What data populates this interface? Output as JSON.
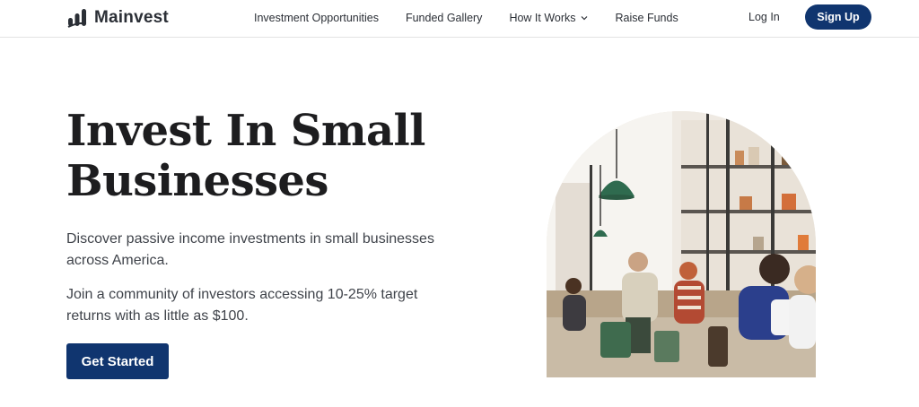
{
  "brand": {
    "name": "Mainvest",
    "logo_icon": "bar-chart-logo-icon"
  },
  "nav": {
    "items": [
      {
        "label": "Investment Opportunities"
      },
      {
        "label": "Funded Gallery"
      },
      {
        "label": "How It Works",
        "has_dropdown": true
      },
      {
        "label": "Raise Funds"
      }
    ],
    "login": "Log In",
    "signup": "Sign Up"
  },
  "hero": {
    "title": "Invest In Small Businesses",
    "paragraph1": "Discover passive income investments in small businesses across America.",
    "paragraph2": "Join a community of investors accessing 10-25% target returns with as little as $100.",
    "cta": "Get Started",
    "image_icon": "cafe-photo"
  },
  "colors": {
    "primary": "#10356f",
    "text": "#1d1d1f",
    "muted": "#3f434a",
    "divider": "#e2e2e2"
  }
}
